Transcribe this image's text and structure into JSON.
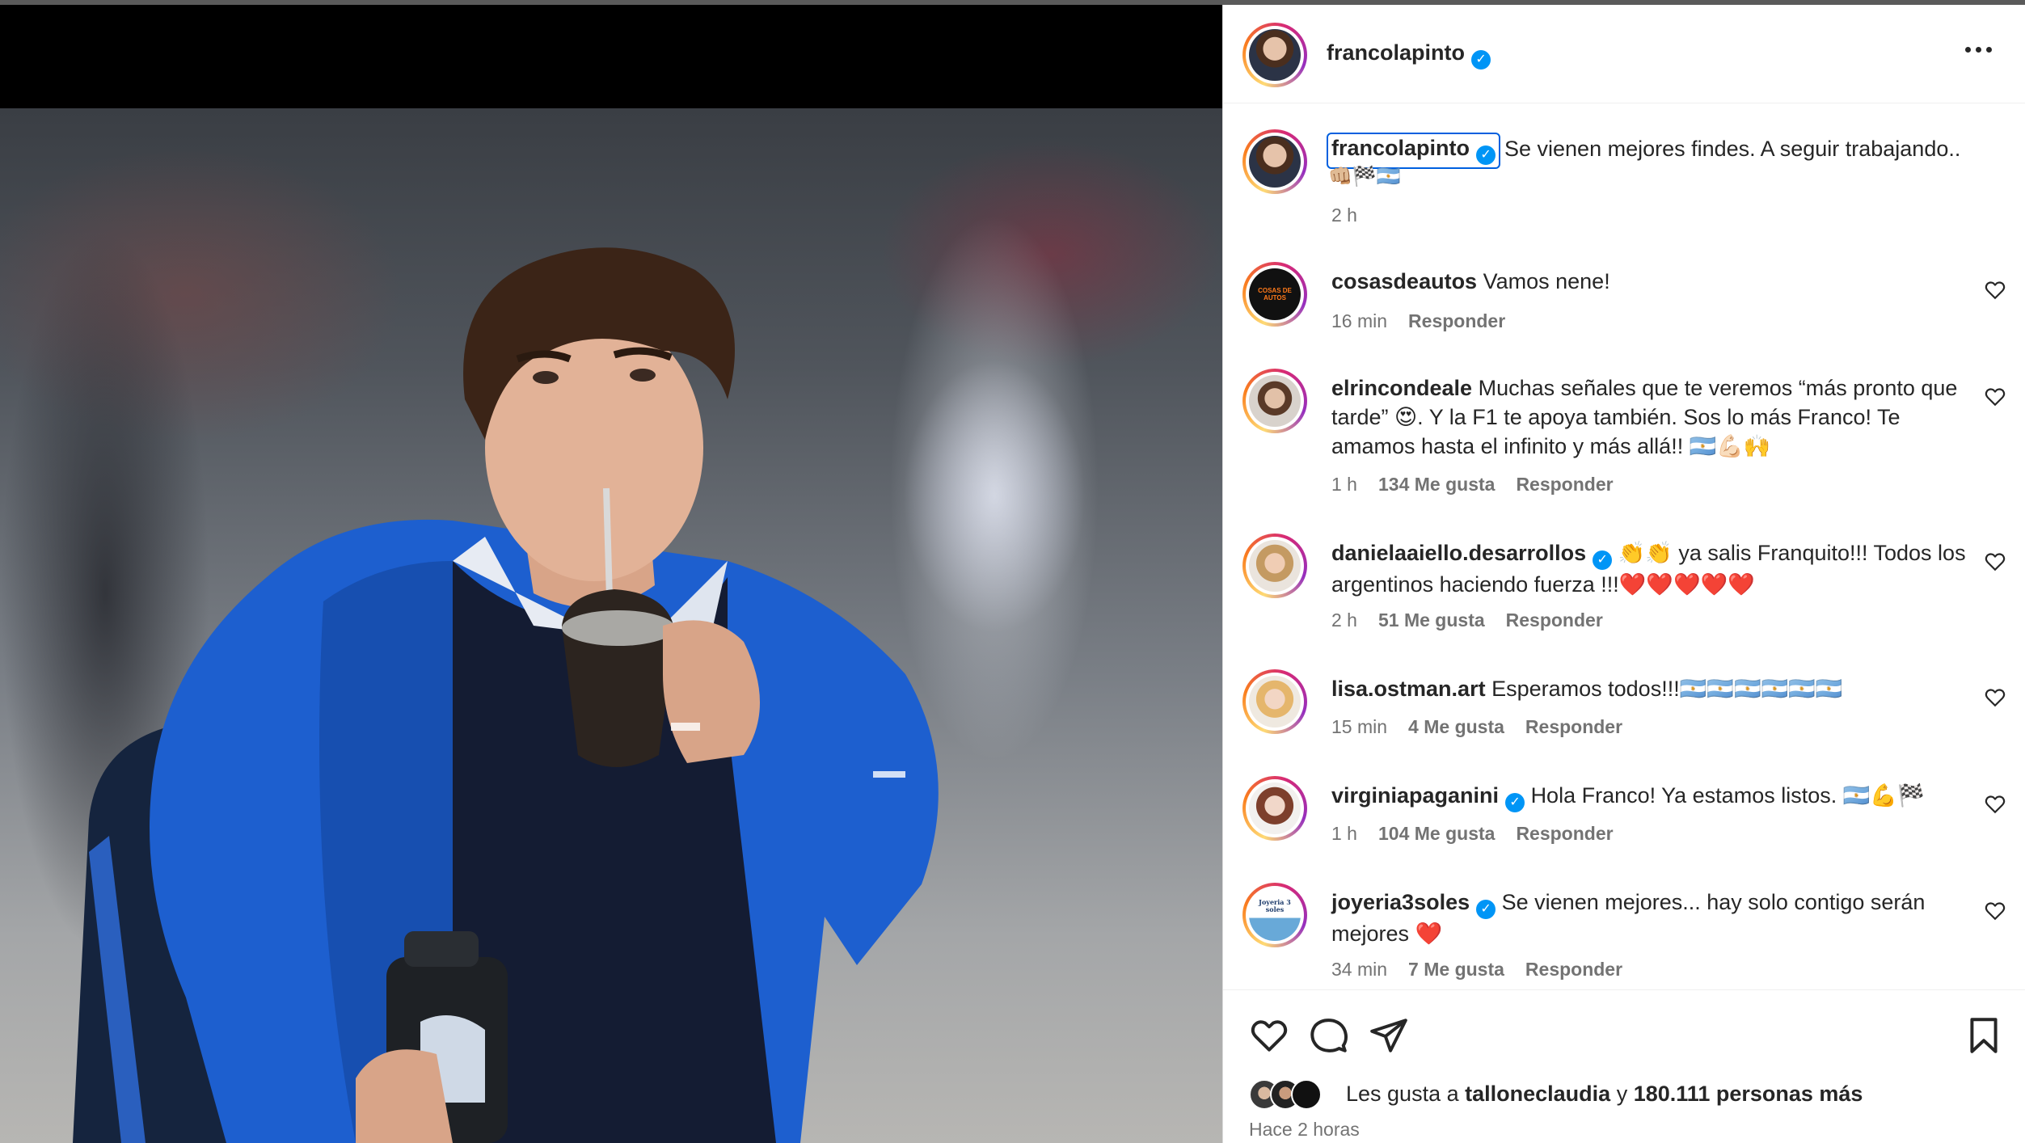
{
  "post": {
    "author": "francolapinto",
    "caption_text": "Se vienen mejores findes. A seguir trabajando..",
    "caption_emoji": "👊🏼🏁🇦🇷",
    "caption_time": "2 h"
  },
  "comments": [
    {
      "user": "cosasdeautos",
      "verified": false,
      "text": "Vamos nene!",
      "time": "16 min",
      "likes": "",
      "reply": "Responder",
      "avatar": "cosas",
      "avatar_text": "COSAS DE AUTOS"
    },
    {
      "user": "elrincondeale",
      "verified": false,
      "text": "Muchas señales que te veremos “más pronto que tarde” 😍. Y la F1 te apoya también. Sos lo más Franco! Te amamos hasta el infinito y más allá!! 🇦🇷💪🏻🙌",
      "time": "1 h",
      "likes": "134 Me gusta",
      "reply": "Responder",
      "avatar": "elrincon"
    },
    {
      "user": "danielaaiello.desarrollos",
      "verified": true,
      "text": "👏👏 ya salis Franquito!!! Todos los argentinos haciendo fuerza !!!❤️❤️❤️❤️❤️",
      "time": "2 h",
      "likes": "51 Me gusta",
      "reply": "Responder",
      "avatar": "daniela"
    },
    {
      "user": "lisa.ostman.art",
      "verified": false,
      "text": "Esperamos todos!!!🇦🇷🇦🇷🇦🇷🇦🇷🇦🇷🇦🇷",
      "time": "15 min",
      "likes": "4 Me gusta",
      "reply": "Responder",
      "avatar": "lisa"
    },
    {
      "user": "virginiapaganini",
      "verified": true,
      "text": "Hola Franco! Ya estamos listos. 🇦🇷💪🏁",
      "time": "1 h",
      "likes": "104 Me gusta",
      "reply": "Responder",
      "avatar": "virginia"
    },
    {
      "user": "joyeria3soles",
      "verified": true,
      "text": "Se vienen mejores... hay solo contigo serán mejores ❤️",
      "time": "34 min",
      "likes": "7 Me gusta",
      "reply": "Responder",
      "avatar": "joyeria",
      "avatar_text": "Joyeria 3 soles"
    }
  ],
  "likes": {
    "prefix": "Les gusta a",
    "user": "talloneclaudia",
    "connector": "y",
    "others": "180.111 personas más"
  },
  "post_time": "Hace 2 horas",
  "icons": {
    "like": "heart-icon",
    "comment": "comment-icon",
    "share": "send-icon",
    "save": "bookmark-icon",
    "more": "more-options-icon",
    "verified": "verified-badge-icon"
  },
  "colors": {
    "verified": "#0095f6",
    "muted_text": "#737373",
    "primary_text": "#262626",
    "focus_outline": "#0060df"
  }
}
